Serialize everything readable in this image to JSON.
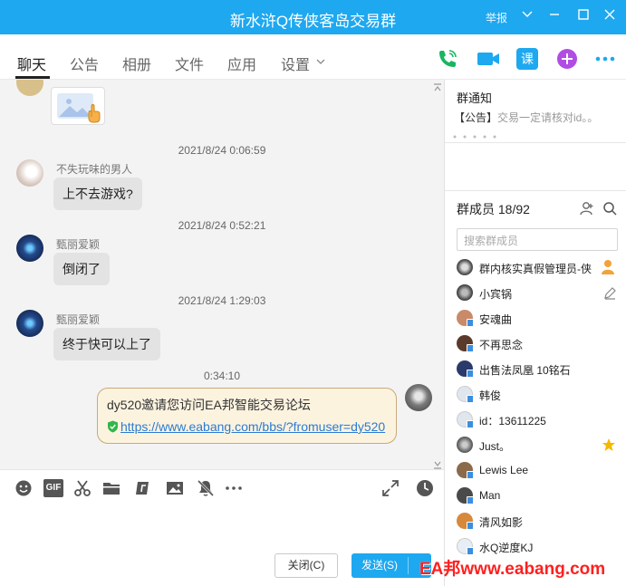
{
  "window": {
    "title": "新水浒Q传侠客岛交易群",
    "report_label": "举报"
  },
  "tabs": [
    {
      "label": "聊天"
    },
    {
      "label": "公告"
    },
    {
      "label": "相册"
    },
    {
      "label": "文件"
    },
    {
      "label": "应用"
    },
    {
      "label": "设置"
    }
  ],
  "top_icons": [
    "phone-call-icon",
    "video-call-icon",
    "course-icon",
    "add-app-icon",
    "more-icon"
  ],
  "top_icon_labels": {
    "course": "课"
  },
  "chat": {
    "messages": [
      {
        "time": "2021/8/24 0:06:59",
        "sender": "不失玩味的男人",
        "text": "上不去游戏?"
      },
      {
        "time": "2021/8/24 0:52:21",
        "sender": "甄丽爱颖",
        "text": "倒闭了"
      },
      {
        "time": "2021/8/24 1:29:03",
        "sender": "甄丽爱颖",
        "text": "终于快可以上了"
      }
    ],
    "my_message": {
      "time": "0:34:10",
      "line1": "dy520邀请您访问EA邦智能交易论坛",
      "link": "https://www.eabang.com/bbs/?fromuser=dy520"
    }
  },
  "toolbar_icons": [
    "emoji-icon",
    "gif-icon",
    "scissors-icon",
    "folder-icon",
    "music-icon",
    "image-icon",
    "mute-icon",
    "more-icon"
  ],
  "toolbar_gif_label": "GIF",
  "input": {
    "close_label": "关闭(C)",
    "send_label": "发送(S)"
  },
  "right_panel": {
    "notice_title": "群通知",
    "notice_tag": "【公告】",
    "notice_text": "交易一定请核对id。。",
    "members_title": "群成员 18/92",
    "search_placeholder": "搜索群成员",
    "members": [
      {
        "name": "群内核实真假管理员-侠"
      },
      {
        "name": "小宾锅"
      },
      {
        "name": "安魂曲"
      },
      {
        "name": "不再思念"
      },
      {
        "name": "出售法凤凰 10铭石"
      },
      {
        "name": "韩俊"
      },
      {
        "name": "id：13611225"
      },
      {
        "name": "Just。"
      },
      {
        "name": "Lewis Lee"
      },
      {
        "name": "Man"
      },
      {
        "name": "清风如影"
      },
      {
        "name": "水Q逆度KJ"
      }
    ]
  },
  "watermark": "EA邦www.eabang.com",
  "colors": {
    "accent": "#1ea8f0",
    "bubble_mine_bg": "#fcf3df",
    "bubble_other_bg": "#e3e3e3",
    "link": "#2b7bd4"
  }
}
